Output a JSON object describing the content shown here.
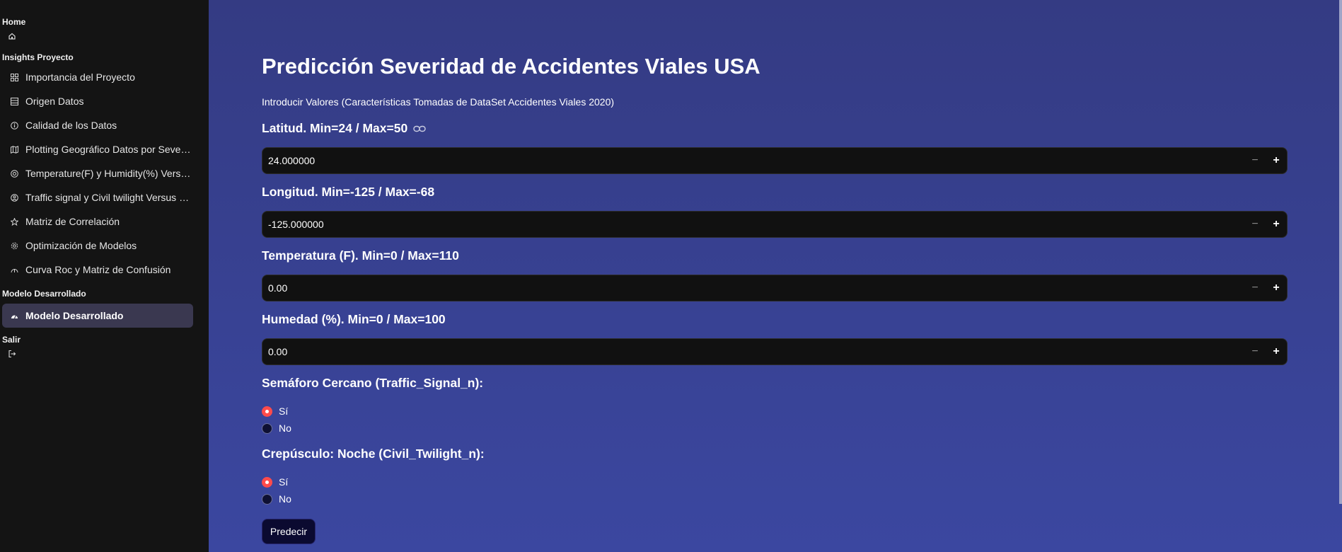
{
  "sidebar": {
    "home_title": "Home",
    "insights_title": "Insights Proyecto",
    "insights_items": [
      {
        "label": "Importancia del Proyecto",
        "icon": "dashboard-icon"
      },
      {
        "label": "Origen Datos",
        "icon": "table-icon"
      },
      {
        "label": "Calidad de los Datos",
        "icon": "info-icon"
      },
      {
        "label": "Plotting Geográfico Datos por Seve…",
        "icon": "map-icon"
      },
      {
        "label": "Temperature(F) y Humidity(%) Vers…",
        "icon": "thermostat-icon"
      },
      {
        "label": "Traffic signal y Civil twilight Versus …",
        "icon": "traffic-icon"
      },
      {
        "label": "Matriz de Correlación",
        "icon": "star-icon"
      },
      {
        "label": "Optimización de Modelos",
        "icon": "gear-icon"
      },
      {
        "label": "Curva Roc y Matriz de Confusión",
        "icon": "chart-icon"
      }
    ],
    "model_title": "Modelo Desarrollado",
    "model_item": {
      "label": "Modelo Desarrollado",
      "icon": "model-icon"
    },
    "exit_title": "Salir"
  },
  "main": {
    "title": "Predicción Severidad de Accidentes Viales USA",
    "intro": "Introducir Valores (Características Tomadas de DataSet Accidentes Viales 2020)",
    "fields": {
      "lat": {
        "label": "Latitud. Min=24 / Max=50",
        "value": "24.000000"
      },
      "lon": {
        "label": "Longitud. Min=-125 / Max=-68",
        "value": "-125.000000"
      },
      "temp": {
        "label": "Temperatura (F). Min=0 / Max=110",
        "value": "0.00"
      },
      "hum": {
        "label": "Humedad (%). Min=0 / Max=100",
        "value": "0.00"
      }
    },
    "stepper": {
      "minus": "−",
      "plus": "+"
    },
    "traffic": {
      "label": "Semáforo Cercano (Traffic_Signal_n):",
      "options": [
        "Sí",
        "No"
      ],
      "selected": "Sí"
    },
    "twilight": {
      "label": "Crepúsculo: Noche (Civil_Twilight_n):",
      "options": [
        "Sí",
        "No"
      ],
      "selected": "Sí"
    },
    "predict_label": "Predecir"
  },
  "colors": {
    "accent_radio": "#ff4b4b",
    "sidebar_bg": "#141414",
    "main_bg_top": "#343b83",
    "main_bg_bottom": "#3b47a0"
  }
}
